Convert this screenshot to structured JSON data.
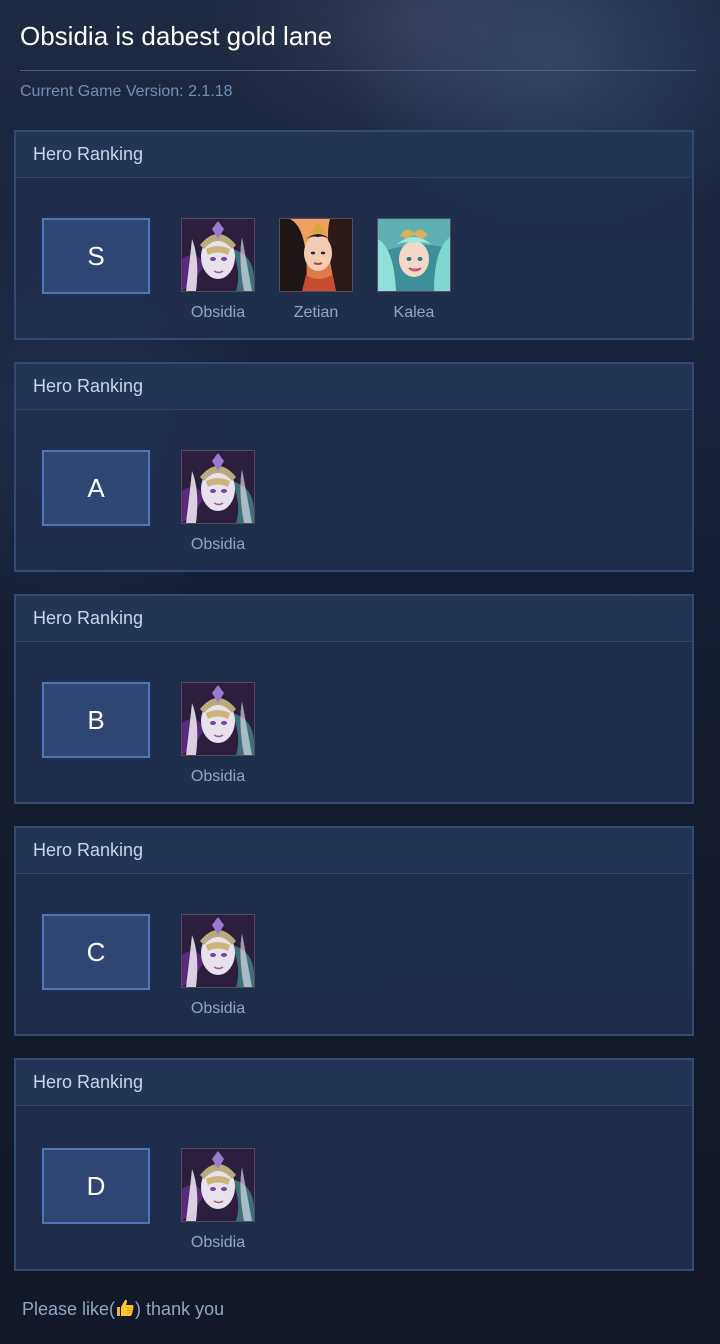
{
  "page": {
    "title": "Obsidia is dabest gold lane",
    "version_text": "Current Game Version: 2.1.18",
    "footer_before": "Please like(",
    "footer_after": ") thank you",
    "footer_icon": "thumbs-up-icon"
  },
  "colors": {
    "background": "#131a2b",
    "card": "#202f4c",
    "card_header": "#233557",
    "badge": "#2f4675",
    "badge_border": "#4f74b8",
    "muted_text": "#8fa7c4"
  },
  "tiers": [
    {
      "header": "Hero Ranking",
      "grade": "S",
      "heroes": [
        {
          "name": "Obsidia",
          "portrait": "obsidia-portrait"
        },
        {
          "name": "Zetian",
          "portrait": "zetian-portrait"
        },
        {
          "name": "Kalea",
          "portrait": "kalea-portrait"
        }
      ]
    },
    {
      "header": "Hero Ranking",
      "grade": "A",
      "heroes": [
        {
          "name": "Obsidia",
          "portrait": "obsidia-portrait"
        }
      ]
    },
    {
      "header": "Hero Ranking",
      "grade": "B",
      "heroes": [
        {
          "name": "Obsidia",
          "portrait": "obsidia-portrait"
        }
      ]
    },
    {
      "header": "Hero Ranking",
      "grade": "C",
      "heroes": [
        {
          "name": "Obsidia",
          "portrait": "obsidia-portrait"
        }
      ]
    },
    {
      "header": "Hero Ranking",
      "grade": "D",
      "heroes": [
        {
          "name": "Obsidia",
          "portrait": "obsidia-portrait"
        }
      ]
    }
  ]
}
